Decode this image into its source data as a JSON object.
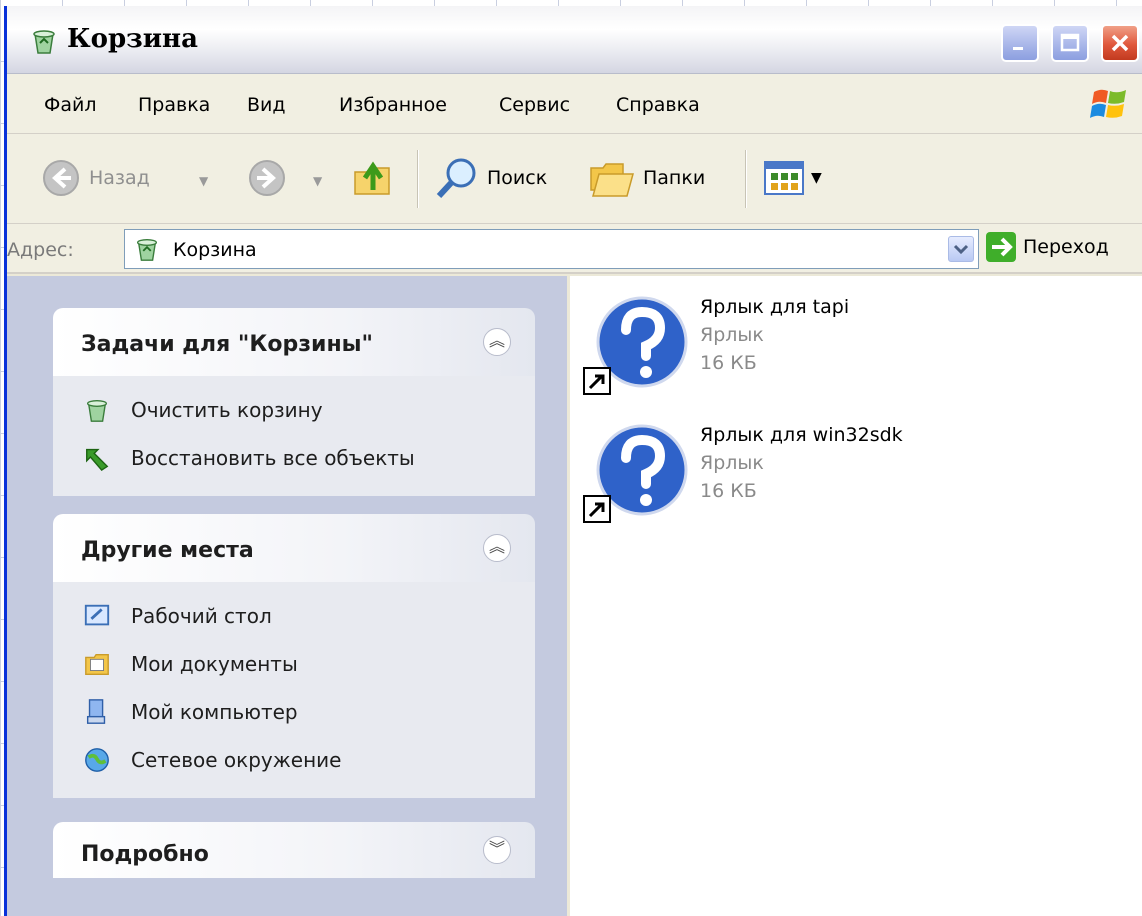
{
  "window": {
    "title": "Корзина",
    "title_icon": "recycle-bin-icon"
  },
  "menu": [
    {
      "label": "Файл"
    },
    {
      "label": "Правка"
    },
    {
      "label": "Вид"
    },
    {
      "label": "Избранное"
    },
    {
      "label": "Сервис"
    },
    {
      "label": "Справка"
    }
  ],
  "toolbar": {
    "back_label": "Назад",
    "search_label": "Поиск",
    "folders_label": "Папки"
  },
  "address": {
    "label": "Адрес:",
    "value": "Корзина",
    "go_label": "Переход"
  },
  "panels": {
    "tasks": {
      "title": "Задачи для \"Корзины\"",
      "items": [
        {
          "label": "Очистить корзину",
          "icon": "empty-recycle-bin-icon"
        },
        {
          "label": "Восстановить все объекты",
          "icon": "restore-icon"
        }
      ]
    },
    "places": {
      "title": "Другие места",
      "items": [
        {
          "label": "Рабочий стол",
          "icon": "desktop-icon"
        },
        {
          "label": "Мои документы",
          "icon": "my-documents-icon"
        },
        {
          "label": "Мой компьютер",
          "icon": "my-computer-icon"
        },
        {
          "label": "Сетевое окружение",
          "icon": "network-icon"
        }
      ]
    },
    "details": {
      "title": "Подробно"
    }
  },
  "files": [
    {
      "name": "Ярлык для tapi",
      "type": "Ярлык",
      "size": "16 КБ",
      "icon": "unknown-shortcut-icon"
    },
    {
      "name": "Ярлык для win32sdk",
      "type": "Ярлык",
      "size": "16 КБ",
      "icon": "unknown-shortcut-icon"
    }
  ],
  "colors": {
    "xp_blue": "#0831d9",
    "taskpane_bg": "#c7cde0",
    "close_red": "#e0583c"
  }
}
